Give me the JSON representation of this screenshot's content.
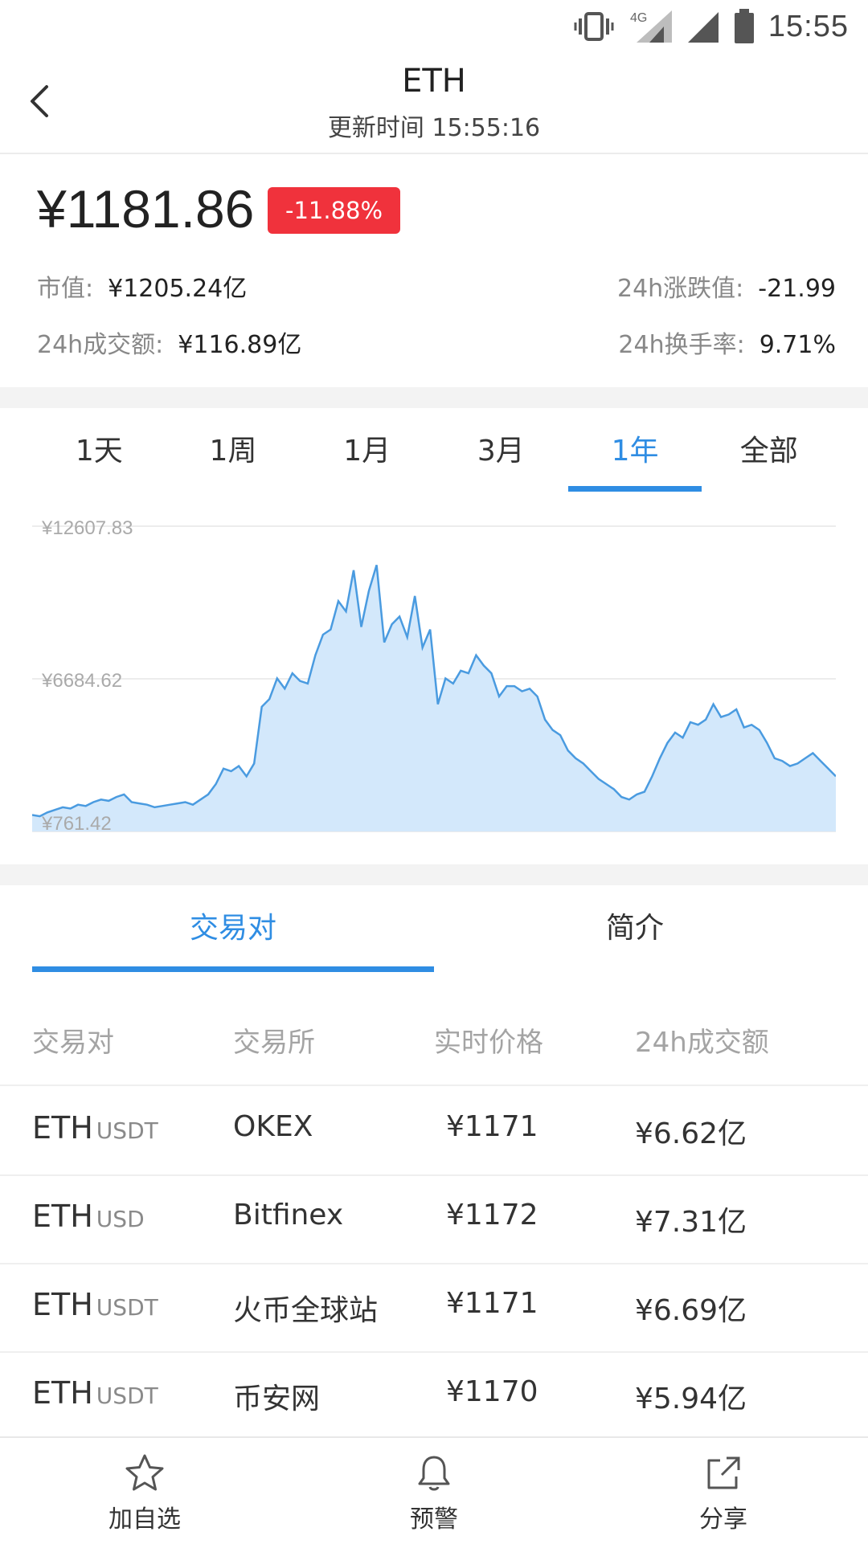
{
  "status_bar": {
    "time": "15:55",
    "network": "4G"
  },
  "header": {
    "title": "ETH",
    "subtitle": "更新时间 15:55:16"
  },
  "summary": {
    "price": "¥1181.86",
    "change_pct": "-11.88%",
    "market_cap_label": "市值:",
    "market_cap": "¥1205.24亿",
    "change_24h_label": "24h涨跌值:",
    "change_24h": "-21.99",
    "volume_24h_label": "24h成交额:",
    "volume_24h": "¥116.89亿",
    "turnover_label": "24h换手率:",
    "turnover": "9.71%"
  },
  "range_tabs": [
    {
      "label": "1天",
      "active": false
    },
    {
      "label": "1周",
      "active": false
    },
    {
      "label": "1月",
      "active": false
    },
    {
      "label": "3月",
      "active": false
    },
    {
      "label": "1年",
      "active": true
    },
    {
      "label": "全部",
      "active": false
    }
  ],
  "chart_data": {
    "type": "area",
    "title": "",
    "xlabel": "",
    "ylabel": "",
    "ylim": [
      761.42,
      12607.83
    ],
    "y_ticks": [
      "¥12607.83",
      "¥6684.62",
      "¥761.42"
    ],
    "grid": true,
    "series": [
      {
        "values": [
          1400,
          1350,
          1500,
          1600,
          1700,
          1650,
          1800,
          1750,
          1900,
          2000,
          1950,
          2100,
          2200,
          1900,
          1850,
          1800,
          1700,
          1750,
          1800,
          1850,
          1900,
          1800,
          2000,
          2200,
          2600,
          3200,
          3100,
          3300,
          2900,
          3400,
          5600,
          5900,
          6700,
          6300,
          6900,
          6600,
          6500,
          7600,
          8400,
          8600,
          9700,
          9300,
          10900,
          8700,
          10100,
          11100,
          8100,
          8800,
          9100,
          8300,
          9900,
          7900,
          8600,
          5700,
          6700,
          6500,
          7000,
          6900,
          7600,
          7200,
          6900,
          6000,
          6400,
          6400,
          6200,
          6300,
          6000,
          5100,
          4700,
          4500,
          3900,
          3600,
          3400,
          3100,
          2800,
          2600,
          2400,
          2100,
          2000,
          2200,
          2300,
          2900,
          3600,
          4200,
          4600,
          4400,
          5000,
          4900,
          5100,
          5700,
          5200,
          5300,
          5500,
          4800,
          4900,
          4700,
          4200,
          3600,
          3500,
          3300,
          3400,
          3600,
          3800,
          3500,
          3200,
          2900
        ]
      }
    ],
    "colors": {
      "line": "#4a9be0",
      "fill": "#d3e8fb"
    }
  },
  "detail_tabs": [
    {
      "label": "交易对",
      "active": true
    },
    {
      "label": "简介",
      "active": false
    }
  ],
  "table": {
    "headers": [
      "交易对",
      "交易所",
      "实时价格",
      "24h成交额"
    ],
    "rows": [
      {
        "base": "ETH",
        "quote": "USDT",
        "exchange": "OKEX",
        "price": "¥1171",
        "volume": "¥6.62亿"
      },
      {
        "base": "ETH",
        "quote": "USD",
        "exchange": "Bitfinex",
        "price": "¥1172",
        "volume": "¥7.31亿"
      },
      {
        "base": "ETH",
        "quote": "USDT",
        "exchange": "火币全球站",
        "price": "¥1171",
        "volume": "¥6.69亿"
      },
      {
        "base": "ETH",
        "quote": "USDT",
        "exchange": "币安网",
        "price": "¥1170",
        "volume": "¥5.94亿"
      }
    ]
  },
  "bottom_bar": {
    "watchlist": {
      "label": "加自选",
      "icon": "star-icon"
    },
    "alert": {
      "label": "预警",
      "icon": "bell-icon"
    },
    "share": {
      "label": "分享",
      "icon": "share-icon"
    }
  }
}
